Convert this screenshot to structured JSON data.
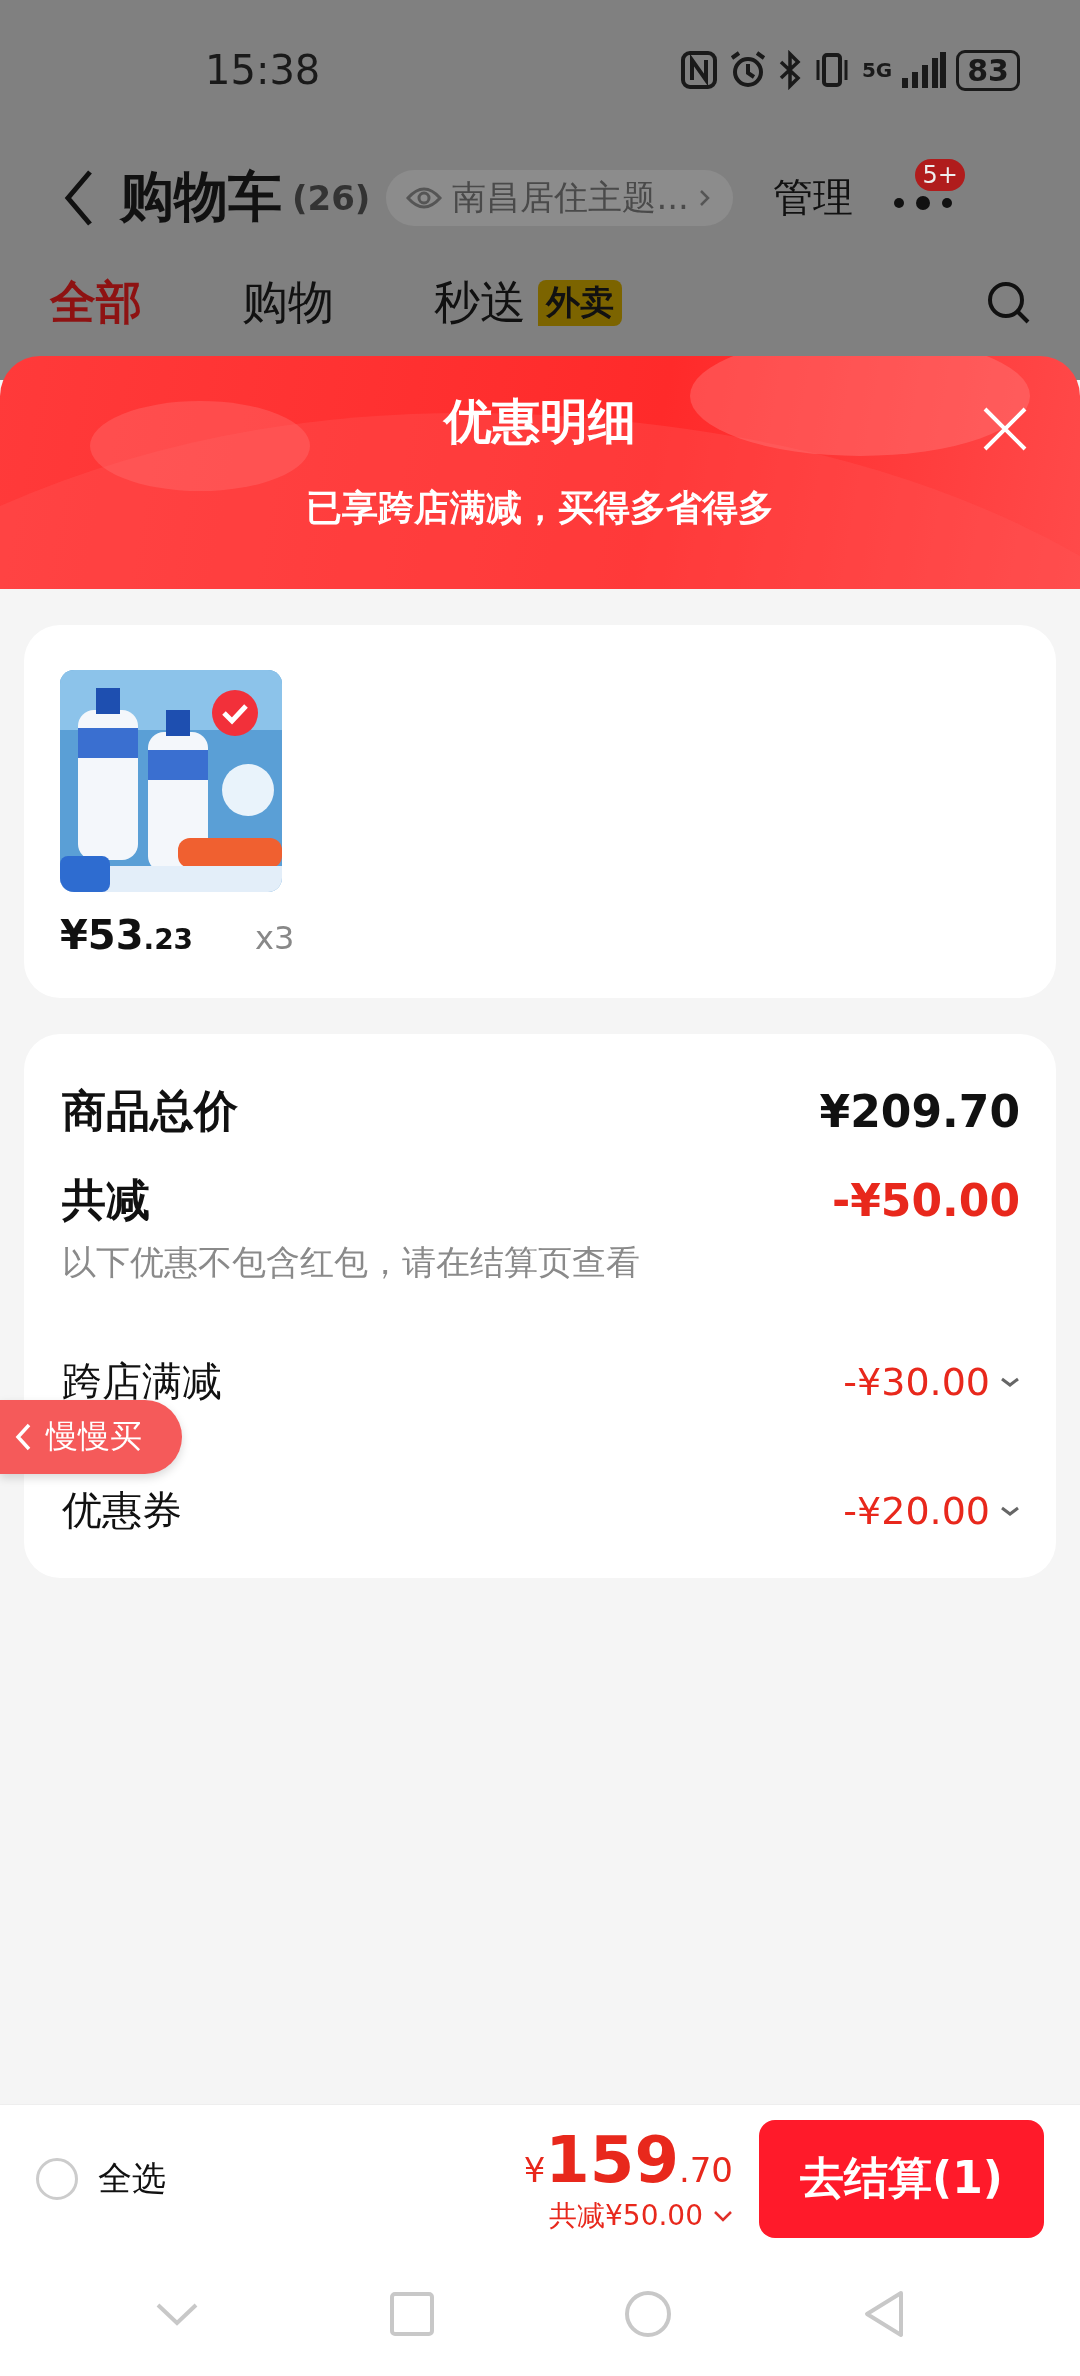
{
  "status_bar": {
    "time": "15:38",
    "network": "5G",
    "battery": "83"
  },
  "header": {
    "title": "购物车",
    "count": "(26)",
    "location": "南昌居住主题...",
    "manage": "管理",
    "more_badge": "5+"
  },
  "tabs": [
    {
      "label": "全部",
      "selected": true
    },
    {
      "label": "购物",
      "selected": false
    },
    {
      "label": "秒送",
      "selected": false,
      "tag": "外卖"
    }
  ],
  "sheet": {
    "title": "优惠明细",
    "subtitle": "已享跨店满减，买得多省得多"
  },
  "items": [
    {
      "kind": "picture",
      "price": "¥53",
      "price_decimal": ".23",
      "quantity": "x3",
      "selected": true
    }
  ],
  "summary": {
    "total_label": "商品总价",
    "total": "¥209.70",
    "reduction_label": "共减",
    "reduction": "-¥50.00",
    "note": "以下优惠不包含红包，请在结算页查看",
    "discounts": [
      {
        "label": "跨店满减",
        "amount": "-¥30.00"
      },
      {
        "label": "优惠券",
        "amount": "-¥20.00"
      }
    ]
  },
  "float_button": "慢慢买",
  "bottom_bar": {
    "select_all": {
      "label": "全选",
      "checked": false
    },
    "currency": "¥",
    "amount": "159",
    "amount_decimal": ".70",
    "saved": "共减¥50.00",
    "checkout": "去结算(1)"
  }
}
